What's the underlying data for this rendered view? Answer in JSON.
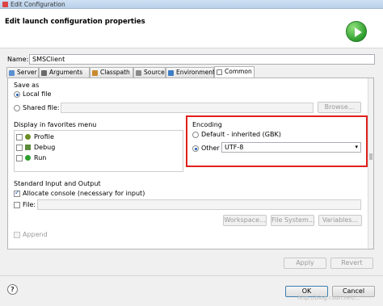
{
  "window": {
    "title": "Edit Configuration"
  },
  "header": {
    "title": "Edit launch configuration properties",
    "icon": "run-icon"
  },
  "name_field": {
    "label": "Name:",
    "value": "SMSClient"
  },
  "tabs": [
    {
      "label": "Server",
      "icon": "server-icon"
    },
    {
      "label": "Arguments",
      "icon": "arguments-icon"
    },
    {
      "label": "Classpath",
      "icon": "classpath-icon"
    },
    {
      "label": "Source",
      "icon": "source-icon"
    },
    {
      "label": "Environment",
      "icon": "environment-icon"
    },
    {
      "label": "Common",
      "icon": "common-icon"
    }
  ],
  "save_as": {
    "title": "Save as",
    "local_file": "Local file",
    "shared_file": "Shared file:",
    "browse": "Browse..."
  },
  "favorites": {
    "title": "Display in favorites menu",
    "items": [
      "Profile",
      "Debug",
      "Run"
    ]
  },
  "encoding": {
    "title": "Encoding",
    "default_label": "Default - inherited (GBK)",
    "other_label": "Other",
    "other_value": "UTF-8"
  },
  "std_io": {
    "title": "Standard Input and Output",
    "allocate_console": "Allocate console (necessary for input)",
    "file_label": "File:",
    "workspace": "Workspace...",
    "file_system": "File System...",
    "variables": "Variables...",
    "append": "Append"
  },
  "actions": {
    "apply": "Apply",
    "revert": "Revert",
    "ok": "OK",
    "cancel": "Cancel"
  },
  "watermark": "http://blog.csdn.net/..."
}
